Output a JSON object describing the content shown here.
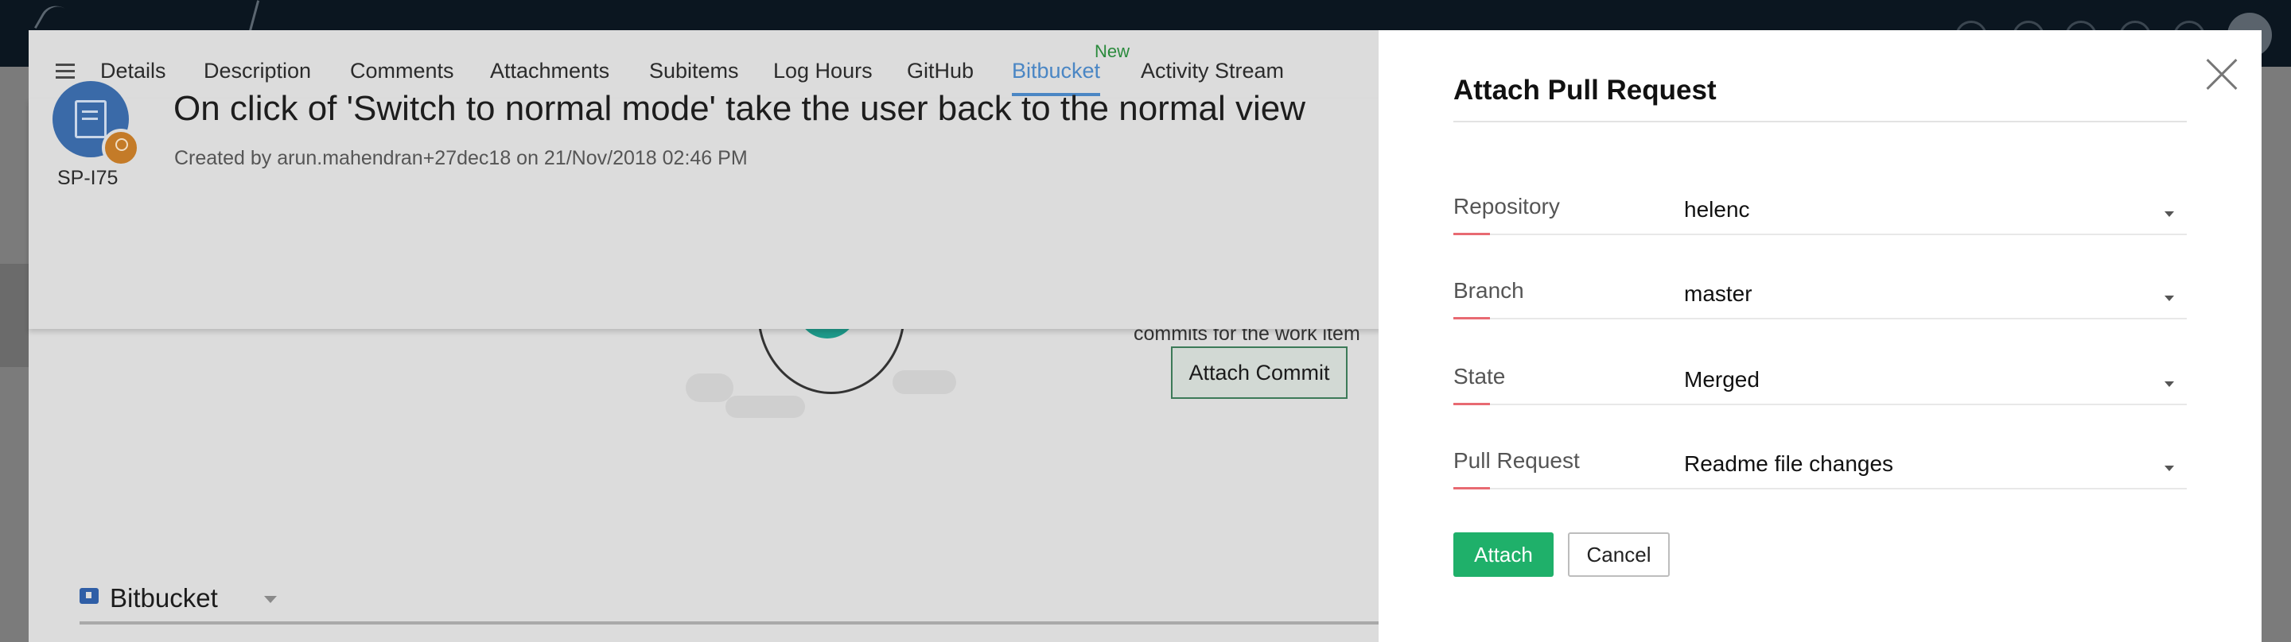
{
  "tabs": [
    {
      "label": "Details"
    },
    {
      "label": "Description"
    },
    {
      "label": "Comments"
    },
    {
      "label": "Attachments"
    },
    {
      "label": "Subitems"
    },
    {
      "label": "Log Hours"
    },
    {
      "label": "GitHub"
    },
    {
      "label": "Bitbucket"
    },
    {
      "label": "Activity Stream"
    }
  ],
  "new_badge": "New",
  "item": {
    "id": "SP-I75",
    "title": "On click of 'Switch to normal mode' take the user back to the normal view",
    "created": "Created by arun.mahendran+27dec18 on 21/Nov/2018 02:46 PM"
  },
  "empty_state": {
    "text": "commits for the work item",
    "button": "Attach Commit"
  },
  "section": {
    "title": "Bitbucket"
  },
  "modal": {
    "title": "Attach Pull Request",
    "fields": [
      {
        "label": "Repository",
        "value": "helenc"
      },
      {
        "label": "Branch",
        "value": "master"
      },
      {
        "label": "State",
        "value": "Merged"
      },
      {
        "label": "Pull Request",
        "value": "Readme file changes"
      }
    ],
    "attach_label": "Attach",
    "cancel_label": "Cancel"
  }
}
